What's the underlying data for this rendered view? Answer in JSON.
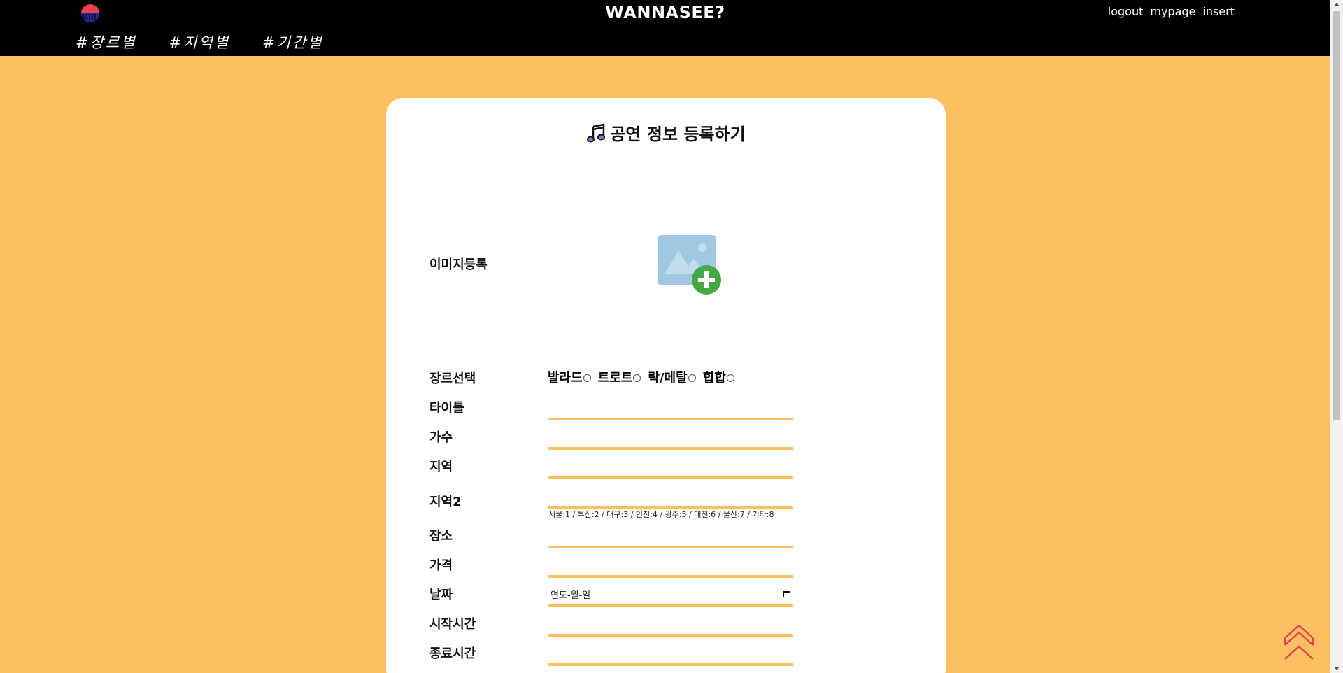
{
  "header": {
    "site_title": "WANNASEE?",
    "logo_icon": "logo-icon",
    "user_nav": [
      "logout",
      "mypage",
      "insert"
    ],
    "categories": [
      "#장르별",
      "#지역별",
      "#기간별"
    ]
  },
  "form": {
    "title": "공연 정보 등록하기",
    "title_icon": "music-note-icon",
    "image_label": "이미지등록",
    "upload_icon": "add-image-icon",
    "genre_label": "장르선택",
    "genres": [
      "발라드",
      "트로트",
      "락/메탈",
      "힙합"
    ],
    "fields": {
      "title": {
        "label": "타이틀",
        "value": ""
      },
      "singer": {
        "label": "가수",
        "value": ""
      },
      "region": {
        "label": "지역",
        "value": ""
      },
      "region2": {
        "label": "지역2",
        "value": ""
      },
      "place": {
        "label": "장소",
        "value": ""
      },
      "price": {
        "label": "가격",
        "value": ""
      },
      "date": {
        "label": "날짜",
        "placeholder": "연도-월-일"
      },
      "start_time": {
        "label": "시작시간",
        "value": ""
      },
      "end_time": {
        "label": "종료시간",
        "value": ""
      }
    },
    "region_hint": "서울:1 / 부산:2 / 대구:3 / 인천:4 / 광주:5 / 대전:6 / 울산:7 / 기타:8"
  },
  "colors": {
    "background": "#ffc062",
    "header": "#000000",
    "card": "#ffffff",
    "field_underline": "#ffc062",
    "to_top": "#e8434d"
  },
  "to_top_icon": "double-chevron-up-icon"
}
